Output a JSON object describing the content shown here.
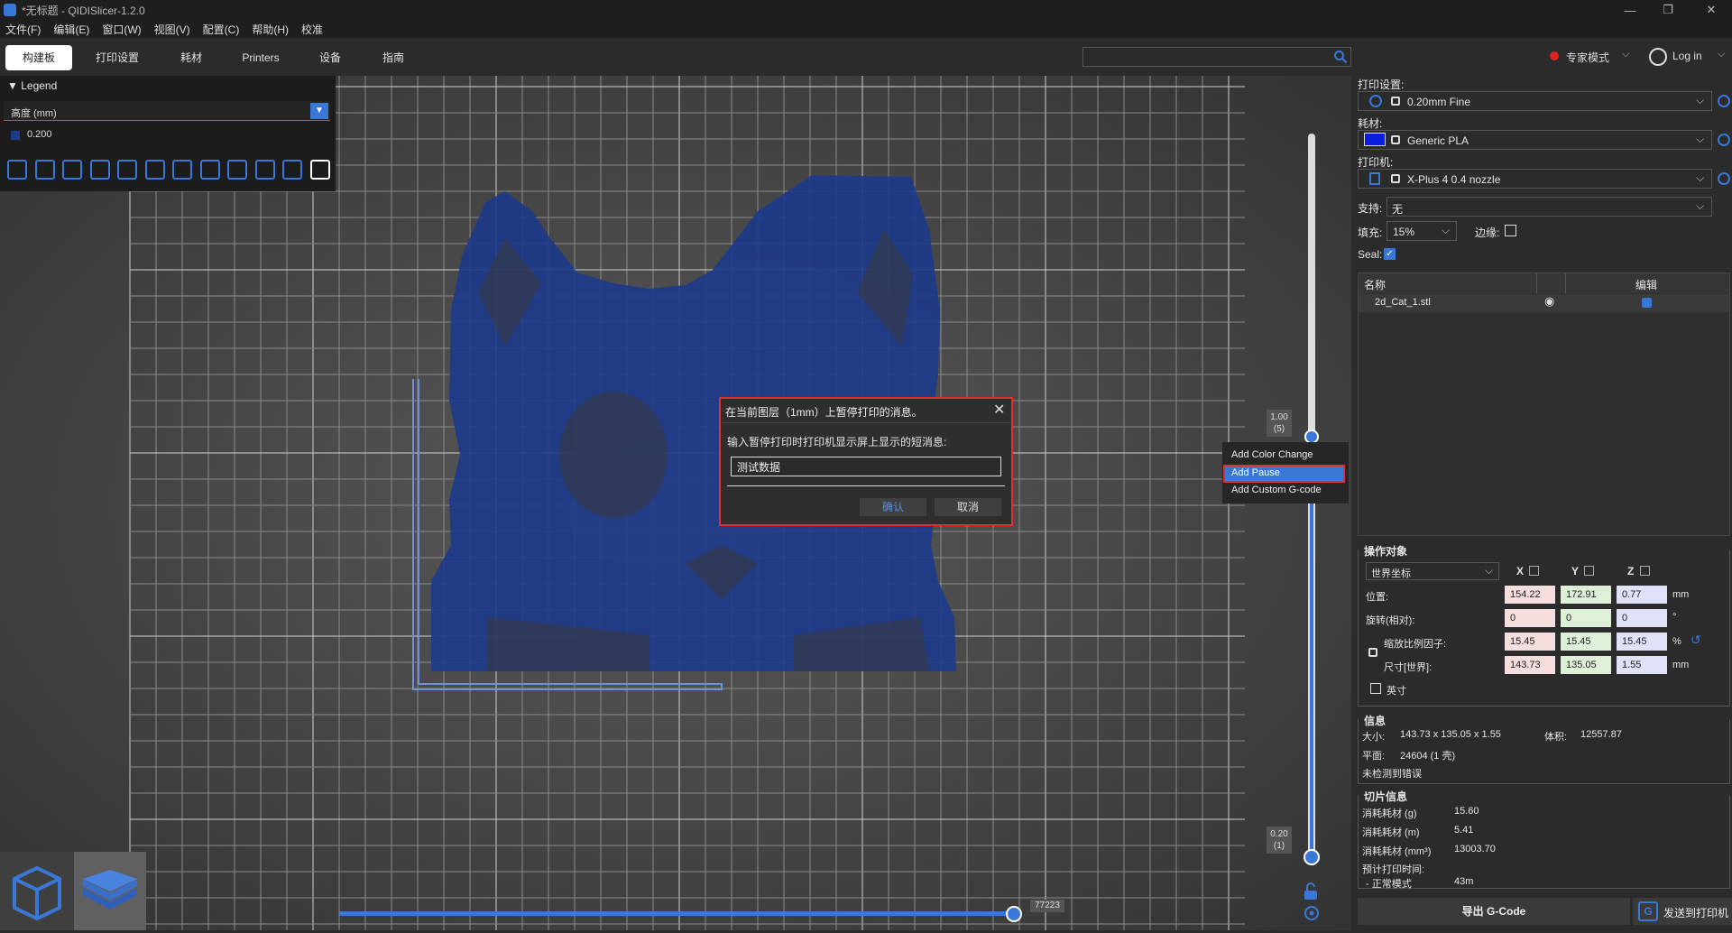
{
  "window": {
    "title": "*无标题 - QIDISlicer-1.2.0"
  },
  "menu": [
    "文件(F)",
    "编辑(E)",
    "窗口(W)",
    "视图(V)",
    "配置(C)",
    "帮助(H)",
    "校准"
  ],
  "tabs": [
    "构建板",
    "打印设置",
    "耗材",
    "Printers",
    "设备",
    "指南"
  ],
  "header": {
    "mode_label": "专家模式",
    "login_label": "Log in"
  },
  "legend": {
    "title": "Legend",
    "select_label": "高度 (mm)",
    "value": "0.200"
  },
  "dialog": {
    "title": "在当前图层（1mm）上暂停打印的消息。",
    "prompt": "输入暂停打印时打印机显示屏上显示的短消息:",
    "input_value": "测试数据",
    "confirm_label": "确认",
    "cancel_label": "取消"
  },
  "context_menu": [
    "Add Color Change",
    "Add Pause",
    "Add Custom G-code"
  ],
  "sliders": {
    "top_label_value": "1.00",
    "top_label_layer": "(5)",
    "bottom_label_value": "0.20",
    "bottom_label_layer": "(1)",
    "horizontal_value": "77223"
  },
  "right_panel": {
    "print_settings_label": "打印设置:",
    "print_settings_value": "0.20mm Fine",
    "filament_label": "耗材:",
    "filament_value": "Generic PLA",
    "filament_color": "#0a1ee0",
    "printer_label": "打印机:",
    "printer_value": "X-Plus 4 0.4 nozzle",
    "support_label": "支持:",
    "support_value": "无",
    "infill_label": "填充:",
    "infill_value": "15%",
    "brim_label": "边缘:",
    "seal_label": "Seal:",
    "seal_checked": true,
    "list_headers": {
      "name": "名称",
      "edit": "编辑"
    },
    "objects": [
      {
        "name": "2d_Cat_1.stl"
      }
    ]
  },
  "manipulation": {
    "title": "操作对象",
    "coord_system": "世界坐标",
    "axes": [
      "X",
      "Y",
      "Z"
    ],
    "position_label": "位置:",
    "position": [
      "154.22",
      "172.91",
      "0.77"
    ],
    "position_unit": "mm",
    "rotation_label": "旋转(相对):",
    "rotation": [
      "0",
      "0",
      "0"
    ],
    "rotation_unit": "°",
    "scale_label": "缩放比例因子:",
    "scale": [
      "15.45",
      "15.45",
      "15.45"
    ],
    "scale_unit": "%",
    "size_label": "尺寸[世界]:",
    "size": [
      "143.73",
      "135.05",
      "1.55"
    ],
    "size_unit": "mm",
    "inch_label": "英寸"
  },
  "info": {
    "title": "信息",
    "size_label": "大小:",
    "size_value": "143.73 x 135.05 x 1.55",
    "volume_label": "体积:",
    "volume_value": "12557.87",
    "facets_label": "平面:",
    "facets_value": "24604 (1 壳)",
    "errors": "未检测到错误"
  },
  "slice_info": {
    "title": "切片信息",
    "rows": [
      {
        "label": "消耗耗材 (g)",
        "value": "15.60"
      },
      {
        "label": "消耗耗材 (m)",
        "value": "5.41"
      },
      {
        "label": "消耗耗材 (mm³)",
        "value": "13003.70"
      }
    ],
    "time_label": "预计打印时间:",
    "mode_label": "- 正常模式",
    "mode_value": "43m"
  },
  "actions": {
    "export_label": "导出 G-Code",
    "send_label": "发送到打印机"
  },
  "colors": {
    "accent": "#3a78d8",
    "model": "#1e3a8a",
    "highlight_border": "#e03030"
  }
}
